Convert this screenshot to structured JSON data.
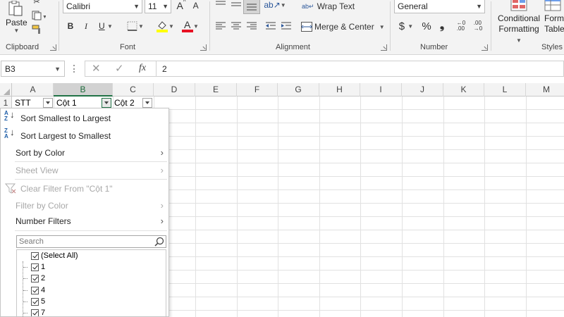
{
  "ribbon": {
    "clipboard": {
      "paste_label": "Paste",
      "group_label": "Clipboard"
    },
    "font": {
      "font_name": "Calibri",
      "font_size": "11",
      "grow_label": "A",
      "shrink_label": "A",
      "bold_label": "B",
      "italic_label": "I",
      "underline_label": "U",
      "font_color_letter": "A",
      "fill_color": "#ffff00",
      "font_color": "#e81123",
      "group_label": "Font"
    },
    "alignment": {
      "wrap_text_label": "Wrap Text",
      "merge_center_label": "Merge & Center",
      "group_label": "Alignment"
    },
    "number": {
      "format_value": "General",
      "currency_symbol": "$",
      "percent_symbol": "%",
      "comma_symbol": "❟",
      "group_label": "Number"
    },
    "styles": {
      "conditional_line1": "Conditional",
      "conditional_line2": "Formatting",
      "format_table_line1": "Forma",
      "format_table_line2": "Table",
      "group_label": "Styles"
    }
  },
  "formula_bar": {
    "name_box": "B3",
    "fx_label": "fx",
    "content": "2"
  },
  "grid": {
    "columns": [
      "A",
      "B",
      "C",
      "D",
      "E",
      "F",
      "G",
      "H",
      "I",
      "J",
      "K",
      "L",
      "M"
    ],
    "active_column": "B",
    "row_headers": [
      "1"
    ],
    "header_cells": {
      "a1": "STT",
      "b1": "Cột 1",
      "c1": "Cột 2"
    }
  },
  "filter_menu": {
    "sort_asc": "Sort Smallest to Largest",
    "sort_desc": "Sort Largest to Smallest",
    "sort_by_color": "Sort by Color",
    "sheet_view": "Sheet View",
    "clear_filter": "Clear Filter From \"Cột 1\"",
    "filter_by_color": "Filter by Color",
    "number_filters": "Number Filters",
    "search_placeholder": "Search",
    "checklist": [
      "(Select All)",
      "1",
      "2",
      "4",
      "5",
      "7"
    ]
  },
  "colors": {
    "accent_green": "#217346",
    "ribbon_bg": "#f3f3f3"
  }
}
